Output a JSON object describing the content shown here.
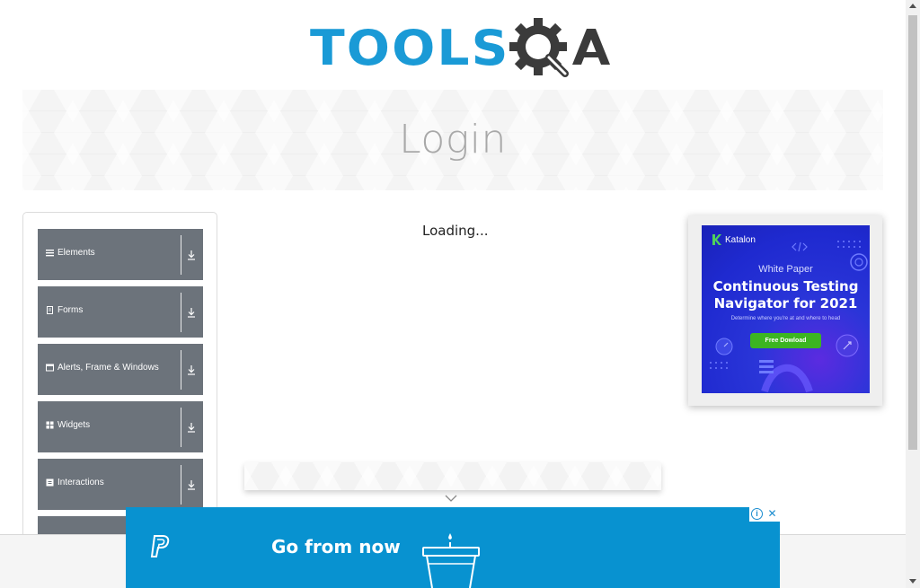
{
  "logo": {
    "part1": "TOOLS",
    "part2": "QA",
    "part1_color": "#1a9ad6",
    "part2_color": "#3b3b3b"
  },
  "banner": {
    "title": "Login"
  },
  "sidebar": {
    "groups": [
      {
        "label": "Elements",
        "icon": "hamburger-icon"
      },
      {
        "label": "Forms",
        "icon": "document-icon"
      },
      {
        "label": "Alerts, Frame & Windows",
        "icon": "window-icon"
      },
      {
        "label": "Widgets",
        "icon": "grid-icon"
      },
      {
        "label": "Interactions",
        "icon": "square-icon"
      },
      {
        "label": "",
        "icon": ""
      }
    ],
    "group_color": "#6c737b"
  },
  "main": {
    "loading_text": "Loading..."
  },
  "side_ad": {
    "brand": "Katalon",
    "subtitle": "White Paper",
    "headline_line1": "Continuous Testing",
    "headline_line2": "Navigator for 2021",
    "description": "Determine where you're at and where to head",
    "button": "Free Dowload",
    "bg_color": "#2a35d8",
    "button_color": "#3cb521"
  },
  "bottom_ad": {
    "text": "Go from now",
    "bg_color": "#0892d0",
    "info_label": "i",
    "close_label": "✕"
  }
}
